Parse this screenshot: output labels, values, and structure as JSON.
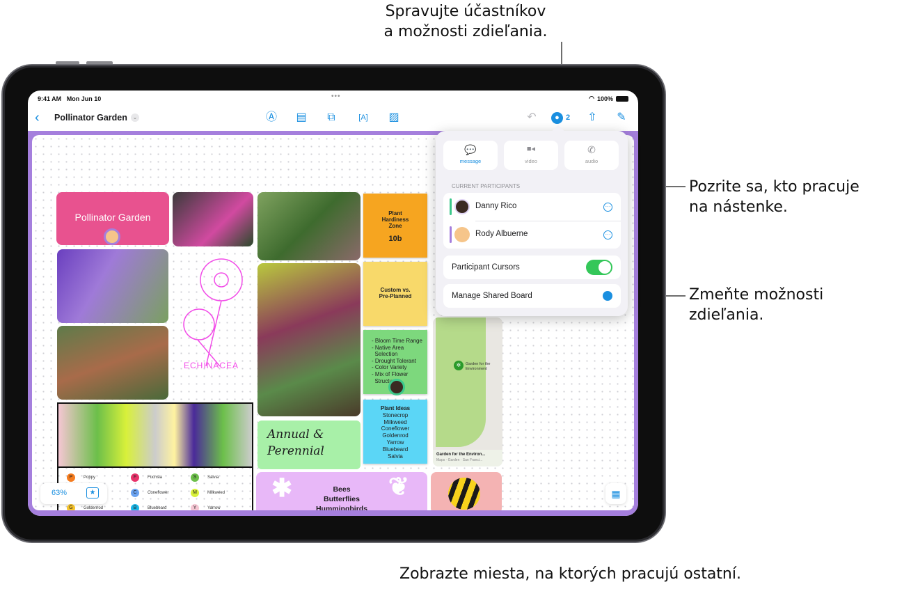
{
  "callouts": {
    "top": [
      "Spravujte účastníkov",
      "a možnosti zdieľania."
    ],
    "participants": [
      "Pozrite sa, kto pracuje",
      "na nástenke."
    ],
    "sharing": [
      "Zmeňte možnosti",
      "zdieľania."
    ],
    "bottom": "Zobrazte miesta, na ktorých pracujú ostatní."
  },
  "status_bar": {
    "time": "9:41 AM",
    "date": "Mon Jun 10",
    "dots": "•••",
    "battery": "100%"
  },
  "toolbar": {
    "back_icon": "chevron-left",
    "title": "Pollinator Garden",
    "title_chevron": "⌄",
    "tools": [
      {
        "name": "pen-tool-icon",
        "glyph": "Ⓐ"
      },
      {
        "name": "sticky-note-icon",
        "glyph": "▤"
      },
      {
        "name": "shapes-icon",
        "glyph": "⧉"
      },
      {
        "name": "text-box-icon",
        "glyph": "[A]"
      },
      {
        "name": "media-icon",
        "glyph": "▨"
      }
    ],
    "undo_glyph": "↶",
    "collab_count": "2",
    "share_glyph": "⇧",
    "compose_glyph": "✎"
  },
  "popover": {
    "actions": [
      {
        "label": "message",
        "glyph": "💬",
        "color": "#1a8fe0"
      },
      {
        "label": "video",
        "glyph": "■◂",
        "color": "#8e8e93"
      },
      {
        "label": "audio",
        "glyph": "✆",
        "color": "#8e8e93"
      }
    ],
    "section_header": "CURRENT PARTICIPANTS",
    "participants": [
      {
        "name": "Danny Rico",
        "accent": "#3cc88c"
      },
      {
        "name": "Rody Albuerne",
        "accent": "#a57fdd"
      }
    ],
    "cursors_label": "Participant Cursors",
    "cursors_on": true,
    "manage_label": "Manage Shared Board"
  },
  "board": {
    "title_card": "Pollinator Garden",
    "stickies": {
      "hardiness": {
        "title": "Plant Hardiness Zone",
        "value": "10b"
      },
      "custom": "Custom vs. Pre-Planned",
      "checklist": [
        "- Bloom Time Range",
        "- Native Area",
        "  Selection",
        "- Drought Tolerant",
        "- Color Variety",
        "- Mix of Flower",
        "  Structure"
      ],
      "plant_ideas": {
        "title": "Plant Ideas",
        "items": [
          "Stonecrop",
          "Milkweed",
          "Coneflower",
          "Goldenrod",
          "Yarrow",
          "Bluebeard",
          "Salvia"
        ]
      }
    },
    "handwriting": {
      "echinacea": "ECHINACEA",
      "annual": [
        "Annual &",
        "Perennial"
      ]
    },
    "map": {
      "pin_label": [
        "Garden for the",
        "Environment"
      ],
      "title": "Garden for the Environ...",
      "subtitle": " Maps · Garden · San Franci..."
    },
    "pollinators": [
      "Bees",
      "Butterflies",
      "Hummingbirds"
    ],
    "legend": [
      {
        "letter": "P",
        "name": "Poppy",
        "color": "#f57c1f"
      },
      {
        "letter": "F",
        "name": "Fuchsia",
        "color": "#e8336a"
      },
      {
        "letter": "S",
        "name": "Salvia",
        "color": "#6cbf4a"
      },
      {
        "letter": "C",
        "name": "Coneflower",
        "color": "#6aa2f0"
      },
      {
        "letter": "M",
        "name": "Milkweed",
        "color": "#d8f03a"
      },
      {
        "letter": "G",
        "name": "Goldenrod",
        "color": "#f7c52c"
      },
      {
        "letter": "B",
        "name": "Bluebeard",
        "color": "#1ab7e8"
      },
      {
        "letter": "Y",
        "name": "Yarrow",
        "color": "#f5c6d3"
      }
    ],
    "zoom_level": "63%",
    "favorite_glyph": "★",
    "grid_glyph": "▦"
  }
}
